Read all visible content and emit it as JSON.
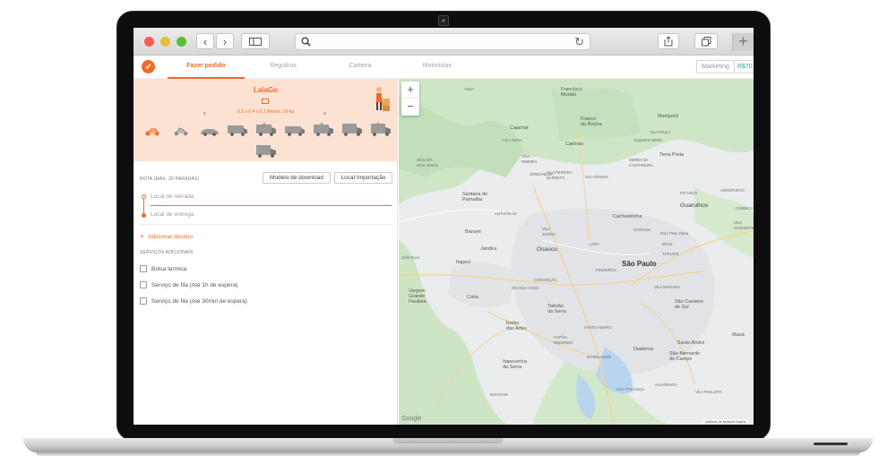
{
  "browser": {
    "url": "",
    "icons": [
      "back-icon",
      "forward-icon",
      "sidebar-icon",
      "search-icon",
      "reload-icon",
      "share-icon",
      "tabs-icon",
      "new-tab-icon"
    ]
  },
  "nav": {
    "tabs": [
      "Fazer pedido",
      "Registros",
      "Carteira",
      "Motoristas"
    ],
    "active_tab": "Fazer pedido",
    "marketing_label": "Marketing",
    "balance": "R$70"
  },
  "vehicle": {
    "name": "LalaGo",
    "dimensions": "0.3 x 0.4 x 0.3 Metros, 20 kg",
    "types": [
      "motorcycle",
      "scooter",
      "car",
      "van",
      "van-2",
      "van-3",
      "van-4",
      "truck",
      "truck-2",
      "truck-3"
    ]
  },
  "route": {
    "label": "ROTA (MÁX. 20 PARADAS)",
    "download_button": "Modelo de download",
    "import_button": "Local Importação",
    "pickup_placeholder": "Local de retirada",
    "dropoff_placeholder": "Local de entrega",
    "add_destination": "Adicionar destino"
  },
  "services": {
    "label": "SERVIÇOS ADICIONAIS",
    "items": [
      {
        "label": "Bolsa térmica",
        "checked": false
      },
      {
        "label": "Serviço de fila (Até 1h de espera)",
        "checked": false
      },
      {
        "label": "Serviço de fila (Até 30min de espera)",
        "checked": false
      }
    ]
  },
  "map": {
    "zoom_in": "+",
    "zoom_out": "−",
    "google": "Google",
    "footer": "Atalhos do teclado    Dados",
    "places": [
      {
        "name": "VIGIA",
        "cls": "small"
      },
      {
        "name": "Francisco\nMorato",
        "cls": ""
      },
      {
        "name": "Mairiporã",
        "cls": ""
      },
      {
        "name": "Franco\nda Rocha",
        "cls": ""
      },
      {
        "name": "Cajamar",
        "cls": ""
      },
      {
        "name": "VILA NOVA",
        "cls": "small"
      },
      {
        "name": "Caieiras",
        "cls": ""
      },
      {
        "name": "VILA PAULA",
        "cls": "small"
      },
      {
        "name": "JUQUERI MIRIM",
        "cls": "small"
      },
      {
        "name": "VILA\nRIBEIRO",
        "cls": "small"
      },
      {
        "name": "Terra Preta",
        "cls": ""
      },
      {
        "name": "SERRA DA\nCANTAREIRA",
        "cls": "small"
      },
      {
        "name": "VILA PEREIRA\nBARRETO",
        "cls": "small"
      },
      {
        "name": "JORDANÉSIA",
        "cls": "small"
      },
      {
        "name": "VILA ROSINA",
        "cls": "small"
      },
      {
        "name": "PICANÇO",
        "cls": "small"
      },
      {
        "name": "AEROPORTO",
        "cls": "small"
      },
      {
        "name": "SEGADA\nBOM JESUS",
        "cls": "small"
      },
      {
        "name": "Santana de\nParnaíba",
        "cls": ""
      },
      {
        "name": "CUMBICA",
        "cls": "small"
      },
      {
        "name": "Guarulhos",
        "cls": "city"
      },
      {
        "name": "VILA\nNASCENTE",
        "cls": "small"
      },
      {
        "name": "ALPHAVILLE",
        "cls": "small"
      },
      {
        "name": "Cachoeirinha",
        "cls": ""
      },
      {
        "name": "VILA\nJOVINA",
        "cls": "small"
      },
      {
        "name": "Barueri",
        "cls": ""
      },
      {
        "name": "SANTANA",
        "cls": "small"
      },
      {
        "name": "Jandira",
        "cls": ""
      },
      {
        "name": "Osasco",
        "cls": "city"
      },
      {
        "name": "LAPA",
        "cls": "small"
      },
      {
        "name": "BRÁS",
        "cls": "small"
      },
      {
        "name": "TATUAPÉ",
        "cls": "small"
      },
      {
        "name": "João Novo",
        "cls": "small"
      },
      {
        "name": "Itapevi",
        "cls": ""
      },
      {
        "name": "PINHEIROS",
        "cls": "small"
      },
      {
        "name": "São Paulo",
        "cls": "big"
      },
      {
        "name": "CONCEIÇÃO",
        "cls": "small"
      },
      {
        "name": "Vargem\nGrande\nPaulista",
        "cls": ""
      },
      {
        "name": "GRANJA VIANA",
        "cls": "small"
      },
      {
        "name": "VILA MARIANA",
        "cls": "small"
      },
      {
        "name": "Cotia",
        "cls": ""
      },
      {
        "name": "Taboão\nda Serra",
        "cls": ""
      },
      {
        "name": "São Caetano\ndo Sul",
        "cls": ""
      },
      {
        "name": "Embu\ndas Artes",
        "cls": ""
      },
      {
        "name": "SANTO AMARO",
        "cls": "small"
      },
      {
        "name": "CAPÃO\nREDONDO",
        "cls": "small"
      },
      {
        "name": "Diadema",
        "cls": ""
      },
      {
        "name": "Santo André",
        "cls": ""
      },
      {
        "name": "Mauá",
        "cls": ""
      },
      {
        "name": "Itapecerica\nda Serra",
        "cls": ""
      },
      {
        "name": "INTERLAGOS",
        "cls": "small"
      },
      {
        "name": "São Bernardo\ndo Campo",
        "cls": ""
      },
      {
        "name": "VILA ITAGUAÇU",
        "cls": "small"
      },
      {
        "name": "ALVARENGA",
        "cls": "small"
      },
      {
        "name": "VILA PAULISTA",
        "cls": "small"
      },
      {
        "name": "BATISTINI",
        "cls": "small"
      },
      {
        "name": "Rod. Pres. Dutra",
        "cls": "small"
      }
    ]
  },
  "colors": {
    "accent": "#f26a26",
    "card_bg": "#fbe2d3",
    "balance": "#27a87d"
  }
}
